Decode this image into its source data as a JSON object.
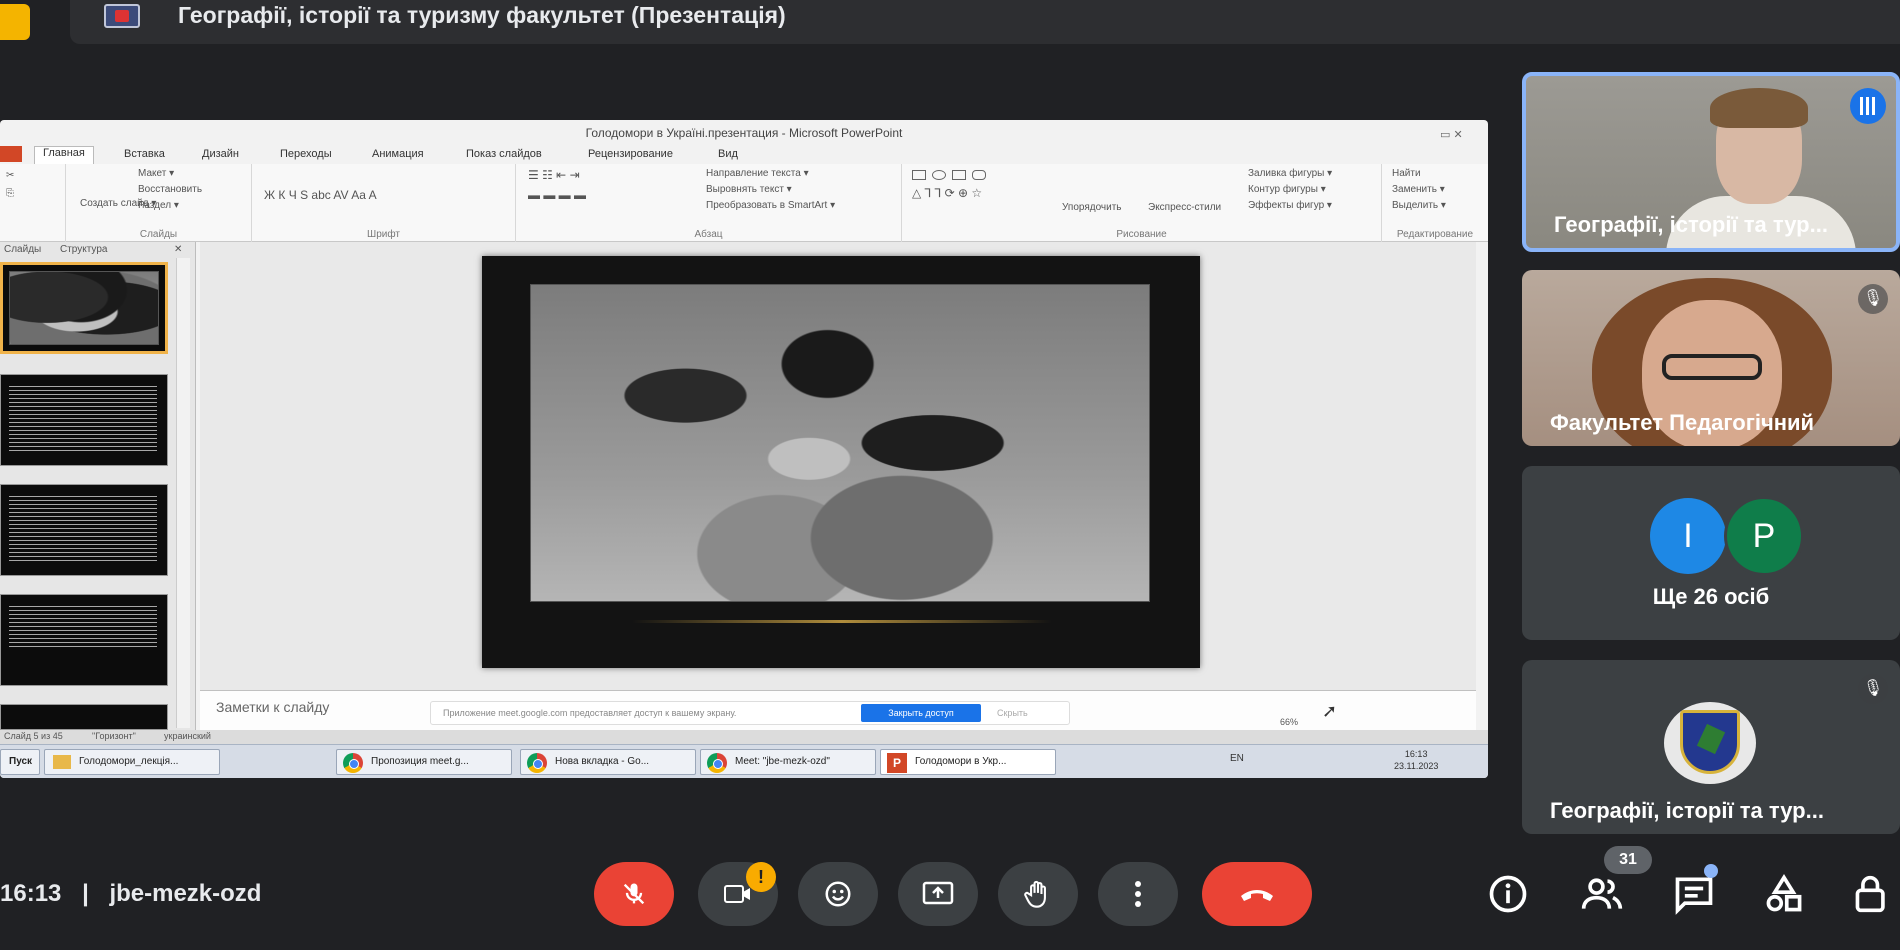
{
  "header": {
    "presentation_title": "Географії, історії та туризму факультет (Презентація)"
  },
  "ppt": {
    "window_title": "Голодомори в Україні.презентация - Microsoft PowerPoint",
    "tabs": [
      "Главная",
      "Вставка",
      "Дизайн",
      "Переходы",
      "Анимация",
      "Показ слайдов",
      "Рецензирование",
      "Вид"
    ],
    "ribbon": {
      "maket": "Макет ▾",
      "restore": "Восстановить",
      "section": "Раздел ▾",
      "create_slide": "Создать слайд ▾",
      "slides_group": "Слайды",
      "font_group": "Шрифт",
      "paragraph_group": "Абзац",
      "text_direction": "Направление текста ▾",
      "align_text": "Выровнять текст ▾",
      "smartart": "Преобразовать в SmartArt ▾",
      "arrange": "Упорядочить",
      "quick_styles": "Экспресс-стили",
      "shape_fill": "Заливка фигуры ▾",
      "shape_outline": "Контур фигуры ▾",
      "shape_effects": "Эффекты фигур ▾",
      "drawing_group": "Рисование",
      "find": "Найти",
      "replace": "Заменить ▾",
      "select": "Выделить ▾",
      "editing_group": "Редактирование"
    },
    "panel_tabs": [
      "Слайды",
      "Структура"
    ],
    "notes_placeholder": "Заметки к слайду",
    "share_notice": "Приложение meet.google.com предоставляет доступ к вашему экрану.",
    "share_stop_button": "Закрыть доступ",
    "share_hide_button": "Скрыть",
    "status": {
      "slide_count": "Слайд 5 из 45",
      "theme": "\"Горизонт\"",
      "language": "украинский",
      "zoom": "66%"
    },
    "taskbar": {
      "start": "Пуск",
      "items": [
        "Голодомори_лекція...",
        "Пропозиция meet.g...",
        "Нова вкладка - Go...",
        "Meet: \"jbe-mezk-ozd\"",
        "Голодомори в Укр..."
      ],
      "tray_lang": "EN",
      "time": "16:13",
      "date": "23.11.2023"
    }
  },
  "participants": [
    {
      "name": "Географії, історії та тур..."
    },
    {
      "name": "Факультет Педагогічний"
    },
    {
      "avatars": [
        "I",
        "P"
      ],
      "label": "Ще 26 осіб"
    },
    {
      "name": "Географії, історії та тур..."
    }
  ],
  "meeting": {
    "time": "16:13",
    "separator": "|",
    "code": "jbe-mezk-ozd",
    "participant_count": "31",
    "camera_warning": "!"
  },
  "colors": {
    "background": "#202124",
    "control": "#3c4043",
    "danger": "#ea4335",
    "accent": "#8ab4f8",
    "warning": "#f9ab00"
  }
}
